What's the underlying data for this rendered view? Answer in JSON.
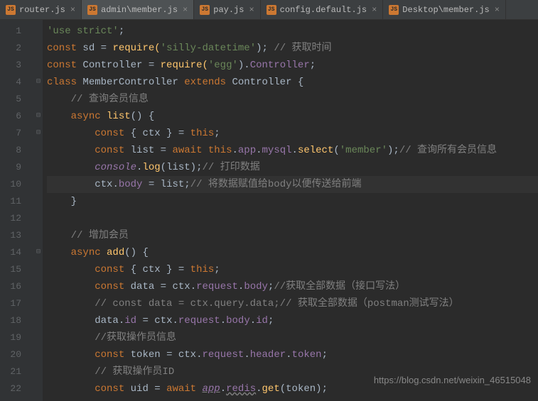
{
  "tabs": [
    {
      "label": "router.js",
      "active": false
    },
    {
      "label": "admin\\member.js",
      "active": true
    },
    {
      "label": "pay.js",
      "active": false
    },
    {
      "label": "config.default.js",
      "active": false
    },
    {
      "label": "Desktop\\member.js",
      "active": false
    }
  ],
  "watermark": "https://blog.csdn.net/weixin_46515048",
  "gutter": [
    "1",
    "2",
    "3",
    "4",
    "5",
    "6",
    "7",
    "8",
    "9",
    "10",
    "11",
    "12",
    "13",
    "14",
    "15",
    "16",
    "17",
    "18",
    "19",
    "20",
    "21",
    "22"
  ],
  "fold": [
    "",
    "",
    "",
    "⊟",
    "",
    "⊟",
    "⊟",
    "",
    "",
    "",
    "",
    "",
    "",
    "⊟",
    "",
    "",
    "",
    "",
    "",
    "",
    "",
    ""
  ],
  "code": {
    "l1": {
      "a": "'use strict'",
      "b": ";"
    },
    "l2": {
      "a": "const ",
      "b": "sd ",
      "c": "= ",
      "d": "require(",
      "e": "'silly-datetime'",
      "f": "); ",
      "g": "// 获取时间"
    },
    "l3": {
      "a": "const ",
      "b": "Controller ",
      "c": "= ",
      "d": "require(",
      "e": "'egg'",
      "f": ").",
      "g": "Controller",
      "h": ";"
    },
    "l4": {
      "a": "class ",
      "b": "MemberController ",
      "c": "extends ",
      "d": "Controller ",
      "e": "{"
    },
    "l5": {
      "a": "    ",
      "b": "// 查询会员信息"
    },
    "l6": {
      "a": "    ",
      "b": "async ",
      "c": "list",
      "d": "() {"
    },
    "l7": {
      "a": "        ",
      "b": "const ",
      "c": "{ ",
      "d": "ctx ",
      "e": "} = ",
      "f": "this",
      "g": ";"
    },
    "l8": {
      "a": "        ",
      "b": "const ",
      "c": "list ",
      "d": "= ",
      "e": "await ",
      "f": "this",
      "g": ".",
      "h": "app",
      "i": ".",
      "j": "mysql",
      "k": ".",
      "l": "select",
      "m": "(",
      "n": "'member'",
      "o": ");",
      "p": "// 查询所有会员信息"
    },
    "l9": {
      "a": "        ",
      "b": "console",
      "c": ".",
      "d": "log",
      "e": "(",
      "f": "list",
      "g": ");",
      "h": "// 打印数据"
    },
    "l10": {
      "a": "        ",
      "b": "ctx",
      "c": ".",
      "d": "body ",
      "e": "= ",
      "f": "list",
      "g": ";",
      "h": "// 将数据赋值给body以便传送给前端"
    },
    "l11": {
      "a": "    }"
    },
    "l12": {
      "a": ""
    },
    "l13": {
      "a": "    ",
      "b": "// 增加会员"
    },
    "l14": {
      "a": "    ",
      "b": "async ",
      "c": "add",
      "d": "() {"
    },
    "l15": {
      "a": "        ",
      "b": "const ",
      "c": "{ ",
      "d": "ctx ",
      "e": "} = ",
      "f": "this",
      "g": ";"
    },
    "l16": {
      "a": "        ",
      "b": "const ",
      "c": "data ",
      "d": "= ",
      "e": "ctx",
      "f": ".",
      "g": "request",
      "h": ".",
      "i": "body",
      "j": ";",
      "k": "//获取全部数据（接口写法）"
    },
    "l17": {
      "a": "        ",
      "b": "// const data = ctx.query.data;// 获取全部数据（postman测试写法）"
    },
    "l18": {
      "a": "        ",
      "b": "data",
      "c": ".",
      "d": "id ",
      "e": "= ",
      "f": "ctx",
      "g": ".",
      "h": "request",
      "i": ".",
      "j": "body",
      "k": ".",
      "l": "id",
      "m": ";"
    },
    "l19": {
      "a": "        ",
      "b": "//获取操作员信息"
    },
    "l20": {
      "a": "        ",
      "b": "const ",
      "c": "token ",
      "d": "= ",
      "e": "ctx",
      "f": ".",
      "g": "request",
      "h": ".",
      "i": "header",
      "j": ".",
      "k": "token",
      "l": ";"
    },
    "l21": {
      "a": "        ",
      "b": "// 获取操作员ID"
    },
    "l22": {
      "a": "        ",
      "b": "const ",
      "c": "uid ",
      "d": "= ",
      "e": "await ",
      "f": "app",
      "g": ".",
      "h": "redis",
      "i": ".",
      "j": "get",
      "k": "(",
      "l": "token",
      "m": ");"
    }
  }
}
